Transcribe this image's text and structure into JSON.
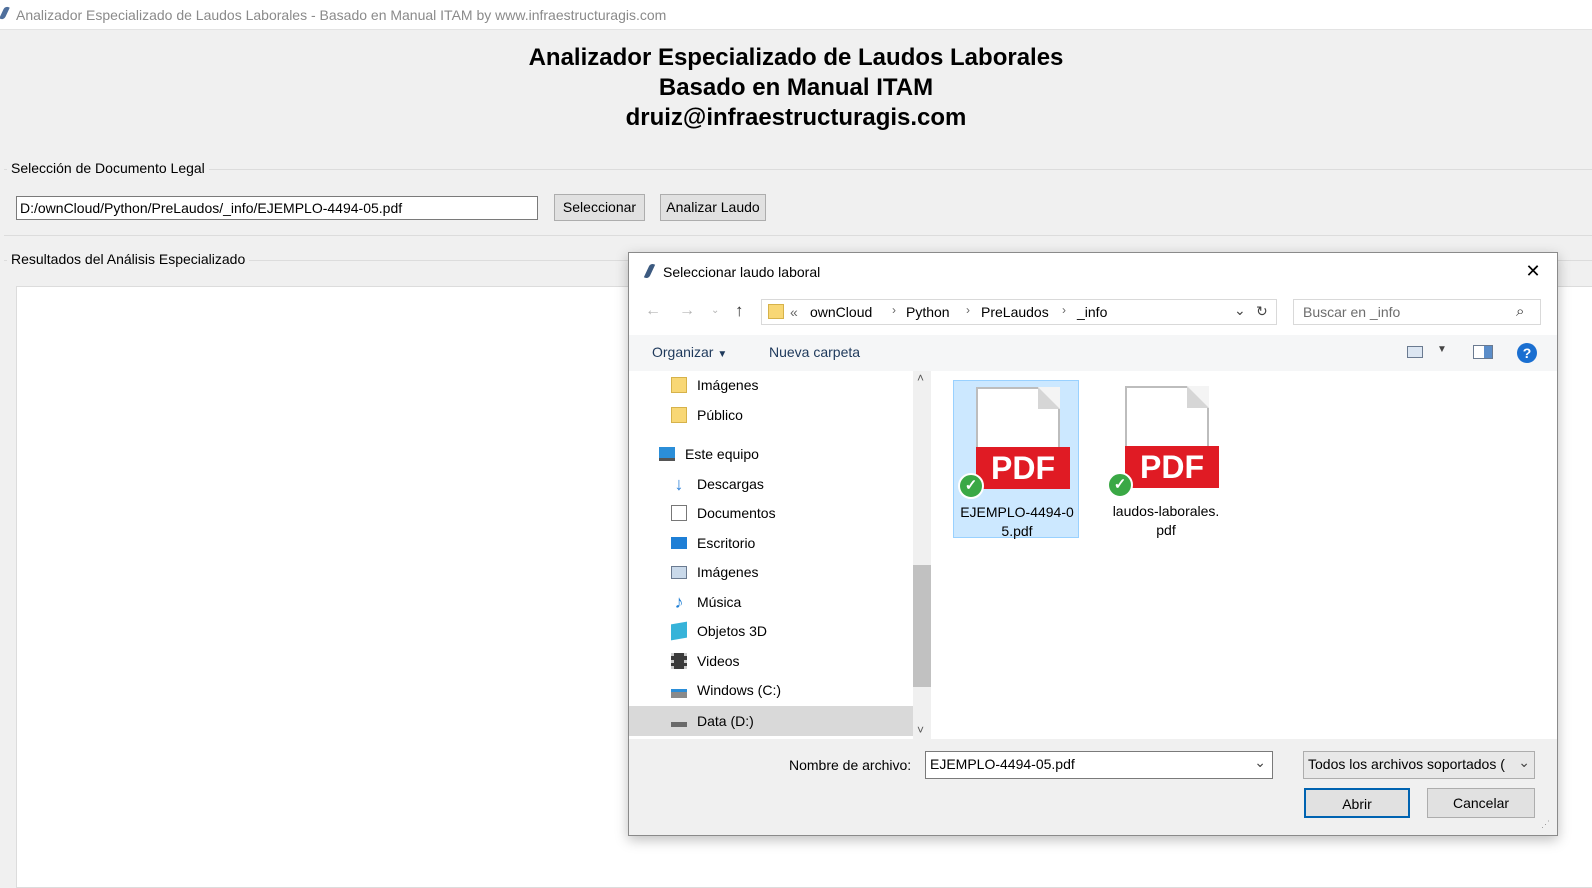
{
  "window": {
    "title": "Analizador Especializado de Laudos Laborales - Basado en Manual ITAM by www.infraestructuragis.com"
  },
  "header": {
    "line1": "Analizador Especializado de Laudos Laborales",
    "line2": "Basado en Manual ITAM",
    "line3": "druiz@infraestructuragis.com"
  },
  "selection": {
    "group_label": "Selección de Documento Legal",
    "path_value": "D:/ownCloud/Python/PreLaudos/_info/EJEMPLO-4494-05.pdf",
    "select_label": "Seleccionar",
    "analyze_label": "Analizar Laudo"
  },
  "results": {
    "group_label": "Resultados del Análisis Especializado"
  },
  "dialog": {
    "title": "Seleccionar laudo laboral",
    "breadcrumb": [
      "«",
      "ownCloud",
      "Python",
      "PreLaudos",
      "_info"
    ],
    "search_placeholder": "Buscar en _info",
    "toolbar": {
      "organize": "Organizar",
      "new_folder": "Nueva carpeta"
    },
    "nav_items": [
      {
        "label": "Imágenes",
        "icon": "folder-icon"
      },
      {
        "label": "Público",
        "icon": "folder-icon"
      },
      {
        "label": "Este equipo",
        "icon": "computer-icon"
      },
      {
        "label": "Descargas",
        "icon": "downloads-icon"
      },
      {
        "label": "Documentos",
        "icon": "documents-icon"
      },
      {
        "label": "Escritorio",
        "icon": "desktop-icon"
      },
      {
        "label": "Imágenes",
        "icon": "pictures-icon"
      },
      {
        "label": "Música",
        "icon": "music-icon"
      },
      {
        "label": "Objetos 3D",
        "icon": "objects-3d-icon"
      },
      {
        "label": "Videos",
        "icon": "videos-icon"
      },
      {
        "label": "Windows (C:)",
        "icon": "drive-c-icon"
      },
      {
        "label": "Data (D:)",
        "icon": "drive-d-icon"
      }
    ],
    "files": [
      {
        "name": "EJEMPLO-4494-05.pdf",
        "line1": "EJEMPLO-4494-0",
        "line2": "5.pdf",
        "badge": "PDF",
        "selected": true
      },
      {
        "name": "laudos-laborales.pdf",
        "line1": "laudos-laborales.",
        "line2": "pdf",
        "badge": "PDF",
        "selected": false
      }
    ],
    "filename_label": "Nombre de archivo:",
    "filename_value": "EJEMPLO-4494-05.pdf",
    "filter_value": "Todos los archivos soportados (",
    "open_label": "Abrir",
    "cancel_label": "Cancelar"
  },
  "colors": {
    "accent": "#0063b1",
    "selection_bg": "#cce8ff",
    "pdf_red": "#e01b24",
    "check_green": "#3aa845"
  }
}
